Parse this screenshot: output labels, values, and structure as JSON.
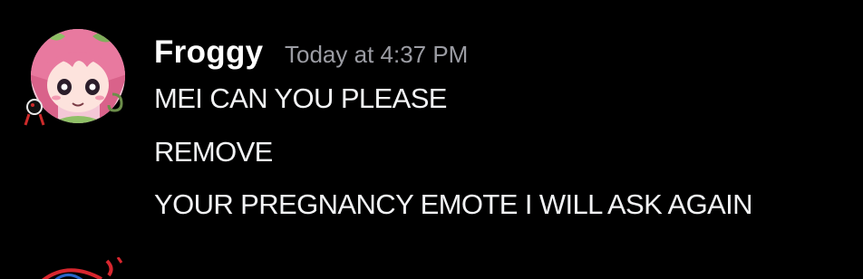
{
  "message": {
    "author": "Froggy",
    "timestamp": "Today at 4:37 PM",
    "lines": [
      "MEI CAN YOU PLEASE",
      "REMOVE",
      "YOUR PREGNANCY EMOTE I WILL ASK AGAIN"
    ]
  },
  "colors": {
    "background": "#000000",
    "author": "#ffffff",
    "timestamp": "#9b9ca3",
    "text": "#f2f3f5",
    "avatar_pink": "#e8799f",
    "avatar_green": "#7fae5b"
  },
  "icons": {
    "avatar": "anime-character-avatar",
    "next_avatar": "partial-avatar"
  }
}
